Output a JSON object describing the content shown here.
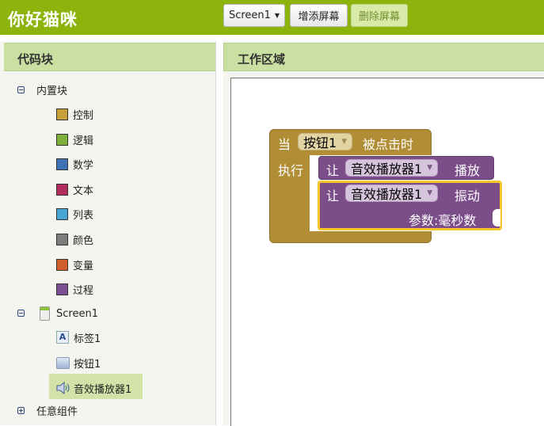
{
  "app": {
    "title": "你好猫咪"
  },
  "toolbar": {
    "screen_select": "Screen1",
    "add_screen": "增添屏幕",
    "remove_screen": "删除屏幕"
  },
  "blocks_panel": {
    "title": "代码块",
    "builtin": {
      "label": "内置块",
      "items": [
        {
          "label": "控制",
          "color": "#c8a13a"
        },
        {
          "label": "逻辑",
          "color": "#7fb03c"
        },
        {
          "label": "数学",
          "color": "#3f71b5"
        },
        {
          "label": "文本",
          "color": "#b32d5e"
        },
        {
          "label": "列表",
          "color": "#49a6d4"
        },
        {
          "label": "颜色",
          "color": "#7d7d7d"
        },
        {
          "label": "变量",
          "color": "#d05f2d"
        },
        {
          "label": "过程",
          "color": "#7c4f93"
        }
      ]
    },
    "screen": {
      "label": "Screen1",
      "components": [
        {
          "label": "标签1",
          "icon": "label-icon"
        },
        {
          "label": "按钮1",
          "icon": "button-icon"
        },
        {
          "label": "音效播放器1",
          "icon": "speaker-icon"
        }
      ]
    },
    "any_component": "任意组件"
  },
  "workspace": {
    "title": "工作区域",
    "event_block": {
      "when": "当",
      "component": "按钮1",
      "event": "被点击时",
      "do": "执行"
    },
    "play_block": {
      "let": "让",
      "component": "音效播放器1",
      "method": "播放"
    },
    "vibrate_block": {
      "let": "让",
      "component": "音效播放器1",
      "method": "振动",
      "param": "参数:毫秒数"
    }
  }
}
